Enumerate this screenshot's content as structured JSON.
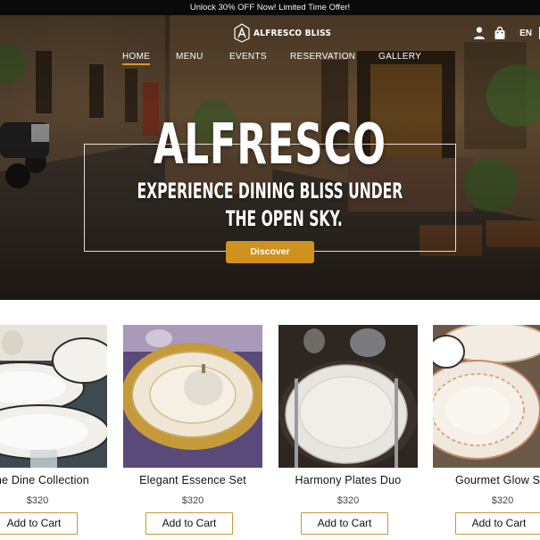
{
  "announcement": {
    "text": "Unlock 30% OFF Now! Limited Time Offer!"
  },
  "header": {
    "logo_text": "ALFRESCO BLISS",
    "language": "EN",
    "icons": [
      "user-icon",
      "shopping-bag-icon"
    ]
  },
  "nav": {
    "items": [
      {
        "label": "HOME",
        "active": true
      },
      {
        "label": "MENU"
      },
      {
        "label": "EVENTS"
      },
      {
        "label": "RESERVATION"
      },
      {
        "label": "GALLERY"
      }
    ]
  },
  "hero": {
    "title": "ALFRESCO",
    "subtitle_line1": "EXPERIENCE DINING BLISS UNDER",
    "subtitle_line2": "THE OPEN SKY.",
    "cta_label": "Discover"
  },
  "colors": {
    "accent": "#cf921f",
    "announce_bg": "#0a0a0a",
    "button_border": "#c79a35"
  },
  "products": [
    {
      "name": "Fine Dine Collection",
      "price": "$320",
      "button": "Add to Cart"
    },
    {
      "name": "Elegant Essence Set",
      "price": "$320",
      "button": "Add to Cart"
    },
    {
      "name": "Harmony Plates Duo",
      "price": "$320",
      "button": "Add to Cart"
    },
    {
      "name": "Gourmet Glow Set",
      "price": "$320",
      "button": "Add to Cart"
    }
  ]
}
